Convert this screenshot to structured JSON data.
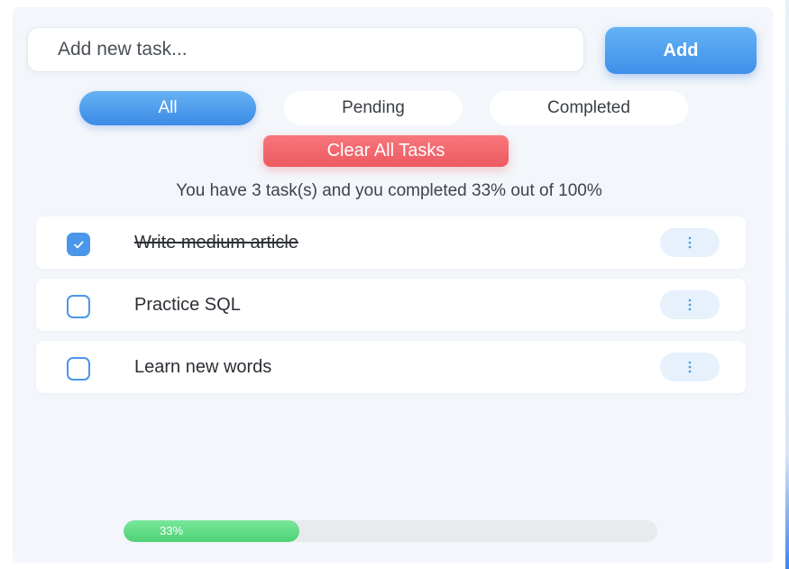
{
  "input": {
    "placeholder": "Add new task...",
    "value": ""
  },
  "add_label": "Add",
  "filters": [
    {
      "label": "All",
      "active": true
    },
    {
      "label": "Pending",
      "active": false
    },
    {
      "label": "Completed",
      "active": false
    }
  ],
  "clear_label": "Clear All Tasks",
  "summary": "You have 3 task(s) and you completed 33% out of 100%",
  "tasks": [
    {
      "label": "Write medium article",
      "completed": true,
      "menu_icon": "vertical-dots-icon"
    },
    {
      "label": "Practice SQL",
      "completed": false,
      "menu_icon": "vertical-dots-icon"
    },
    {
      "label": "Learn new words",
      "completed": false,
      "menu_icon": "vertical-dots-icon"
    }
  ],
  "progress": {
    "fraction": 0.33,
    "label": "33%"
  },
  "colors": {
    "accent": "#4a97ea",
    "danger": "#ec5a5f",
    "success": "#4fd176",
    "panel": "#f3f6fa"
  }
}
